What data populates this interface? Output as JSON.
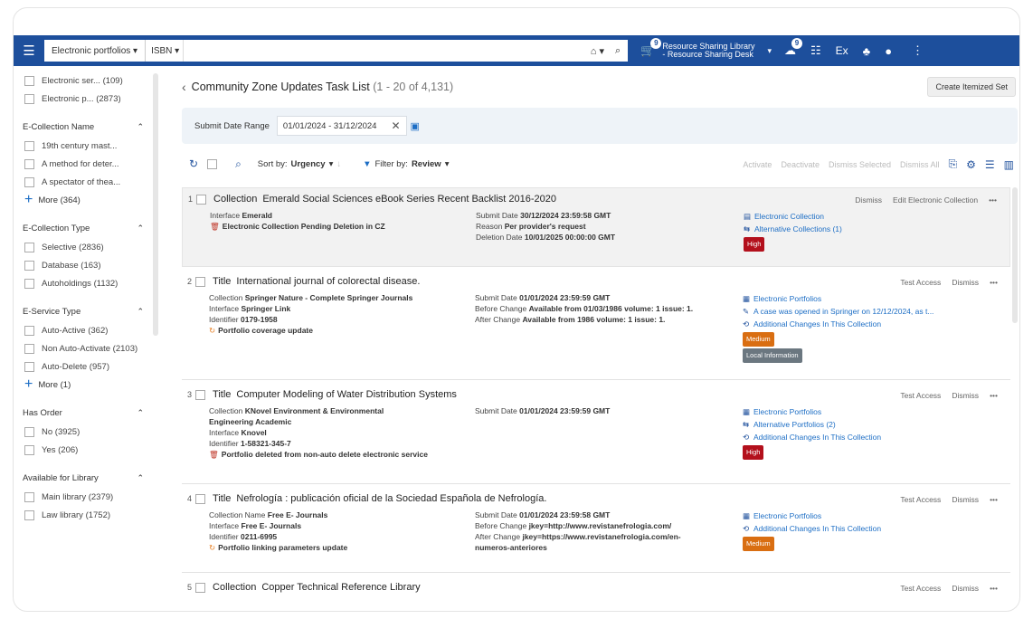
{
  "topbar": {
    "scope_select": "Electronic portfolios ▾",
    "field_select": "ISBN ▾",
    "search_home": "⌂ ▾",
    "search_icon": "⌕",
    "rs_badge": "9",
    "rs_line1": "Resource Sharing Library",
    "rs_line2": "- Resource Sharing Desk",
    "notif_badge": "9",
    "ex_label": "Ex"
  },
  "sidebar": {
    "top_items": [
      {
        "label": "Electronic ser... (109)"
      },
      {
        "label": "Electronic p... (2873)"
      }
    ],
    "groups": [
      {
        "name": "E-Collection Name",
        "items": [
          "19th century mast...",
          "A method for deter...",
          "A spectator of thea..."
        ],
        "more": "More (364)"
      },
      {
        "name": "E-Collection Type",
        "items": [
          "Selective (2836)",
          "Database (163)",
          "Autoholdings (1132)"
        ],
        "more": ""
      },
      {
        "name": "E-Service Type",
        "items": [
          "Auto-Active (362)",
          "Non Auto-Activate (2103)",
          "Auto-Delete (957)"
        ],
        "more": "More (1)"
      },
      {
        "name": "Has Order",
        "items": [
          "No (3925)",
          "Yes (206)"
        ],
        "more": ""
      },
      {
        "name": "Available for Library",
        "items": [
          "Main library (2379)",
          "Law library (1752)"
        ],
        "more": ""
      }
    ]
  },
  "main": {
    "title": "Community Zone Updates Task List",
    "count": "(1 - 20 of 4,131)",
    "create_btn": "Create Itemized Set",
    "date_label": "Submit Date Range",
    "date_value": "01/01/2024 - 31/12/2024",
    "sort_label": "Sort by:",
    "sort_value": "Urgency",
    "filter_label": "Filter by:",
    "filter_value": "Review",
    "actions": [
      "Activate",
      "Deactivate",
      "Dismiss Selected",
      "Dismiss All"
    ]
  },
  "rows": [
    {
      "num": "1",
      "kind": "Collection",
      "title": "Emerald Social Sciences eBook Series Recent Backlist 2016-2020",
      "acts": [
        "Dismiss",
        "Edit Electronic Collection",
        "•••"
      ],
      "c1": [
        {
          "k": "Interface",
          "v": "Emerald"
        },
        {
          "k": "",
          "v": "Electronic Collection Pending Deletion in CZ",
          "icon": "trash"
        }
      ],
      "c2": [
        {
          "k": "Submit Date",
          "v": "30/12/2024 23:59:58 GMT"
        },
        {
          "k": "Reason",
          "v": "Per provider's request"
        },
        {
          "k": "Deletion Date",
          "v": "10/01/2025 00:00:00 GMT"
        }
      ],
      "c3": [
        {
          "icon": "coll",
          "t": "Electronic Collection"
        },
        {
          "icon": "alt",
          "t": "Alternative Collections (1)"
        }
      ],
      "pills": [
        {
          "t": "High",
          "c": "#b3101c"
        }
      ]
    },
    {
      "num": "2",
      "kind": "Title",
      "title": "International journal of colorectal disease.",
      "acts": [
        "Test Access",
        "Dismiss",
        "•••"
      ],
      "c1": [
        {
          "k": "Collection",
          "v": "Springer Nature - Complete Springer Journals"
        },
        {
          "k": "Interface",
          "v": "Springer Link"
        },
        {
          "k": "Identifier",
          "v": "0179-1958"
        },
        {
          "k": "",
          "v": "Portfolio coverage update",
          "icon": "sync"
        }
      ],
      "c2": [
        {
          "k": "Submit Date",
          "v": "01/01/2024 23:59:59 GMT"
        },
        {
          "k": "Before Change",
          "v": "Available from 01/03/1986 volume: 1 issue: 1."
        },
        {
          "k": "After Change",
          "v": "Available from 1986 volume: 1 issue: 1."
        }
      ],
      "c3": [
        {
          "icon": "port",
          "t": "Electronic Portfolios"
        },
        {
          "icon": "case",
          "t": "A case was opened in Springer on 12/12/2024, as t..."
        },
        {
          "icon": "hist",
          "t": "Additional Changes In This Collection"
        }
      ],
      "pills": [
        {
          "t": "Medium",
          "c": "#d96e12"
        },
        {
          "t": "Local Information",
          "c": "#6b7780"
        }
      ]
    },
    {
      "num": "3",
      "kind": "Title",
      "title": "Computer Modeling of Water Distribution Systems",
      "acts": [
        "Test Access",
        "Dismiss",
        "•••"
      ],
      "c1": [
        {
          "k": "Collection",
          "v": "KNovel Environment & Environmental"
        },
        {
          "k": "",
          "v": "Engineering Academic",
          "bold": true
        },
        {
          "k": "Interface",
          "v": "Knovel"
        },
        {
          "k": "Identifier",
          "v": "1-58321-345-7"
        },
        {
          "k": "",
          "v": "Portfolio deleted from non-auto delete electronic service",
          "icon": "trash"
        }
      ],
      "c2": [
        {
          "k": "Submit Date",
          "v": "01/01/2024 23:59:59 GMT"
        }
      ],
      "c3": [
        {
          "icon": "port",
          "t": "Electronic Portfolios"
        },
        {
          "icon": "alt",
          "t": "Alternative Portfolios (2)"
        },
        {
          "icon": "hist",
          "t": "Additional Changes In This Collection"
        }
      ],
      "pills": [
        {
          "t": "High",
          "c": "#b3101c"
        }
      ]
    },
    {
      "num": "4",
      "kind": "Title",
      "title": "Nefrología : publicación oficial de la Sociedad Española de Nefrología.",
      "acts": [
        "Test Access",
        "Dismiss",
        "•••"
      ],
      "c1": [
        {
          "k": "Collection Name",
          "v": "Free E- Journals"
        },
        {
          "k": "Interface",
          "v": "Free E- Journals"
        },
        {
          "k": "Identifier",
          "v": "0211-6995"
        },
        {
          "k": "",
          "v": "Portfolio linking parameters update",
          "icon": "sync"
        }
      ],
      "c2": [
        {
          "k": "Submit Date",
          "v": "01/01/2024 23:59:58 GMT"
        },
        {
          "k": "Before Change",
          "v": "jkey=http://www.revistanefrologia.com/"
        },
        {
          "k": "After Change",
          "v": "jkey=https://www.revistanefrologia.com/en-"
        },
        {
          "k": "",
          "v": "numeros-anteriores",
          "bold": true
        }
      ],
      "c3": [
        {
          "icon": "port",
          "t": "Electronic Portfolios"
        },
        {
          "icon": "hist",
          "t": "Additional Changes In This Collection"
        }
      ],
      "pills": [
        {
          "t": "Medium",
          "c": "#d96e12"
        }
      ]
    },
    {
      "num": "5",
      "kind": "Collection",
      "title": "Copper Technical Reference Library",
      "acts": [
        "Test Access",
        "Dismiss",
        "•••"
      ],
      "c1": [],
      "c2": [],
      "c3": [],
      "pills": []
    }
  ]
}
